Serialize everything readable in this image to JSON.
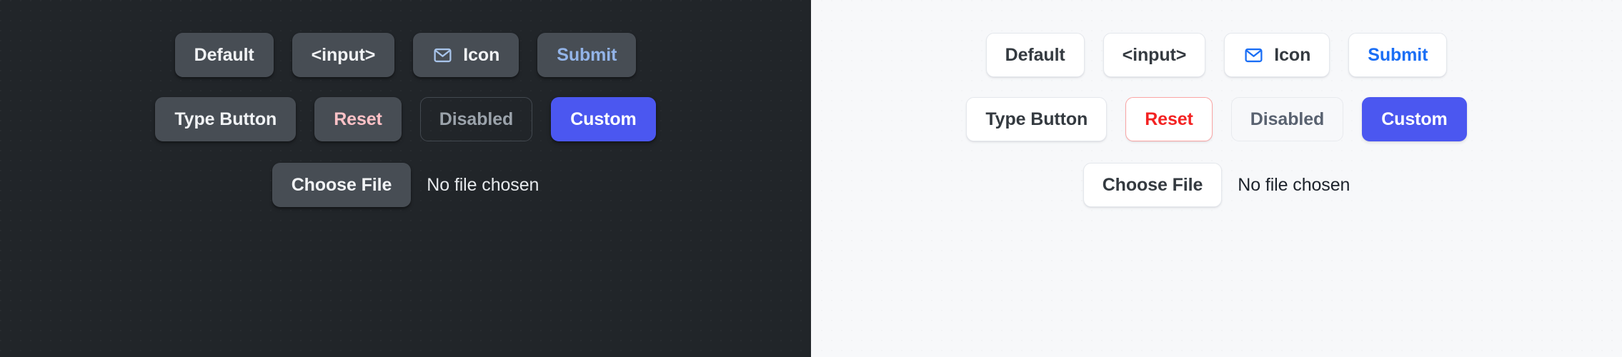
{
  "themes": [
    {
      "name": "dark",
      "colors": {
        "background": "#212529",
        "button_surface": "#474d54",
        "text": "#f1f3f5",
        "submit_text": "#93b4e8",
        "reset_text": "#ffc2c7",
        "disabled_text": "#9ba3ab",
        "disabled_border": "#434950",
        "custom_background": "#4b57f0",
        "custom_text": "#ffffff",
        "icon_stroke": "#a8c4ea",
        "file_name_text": "#e6e9ec"
      },
      "row1": [
        {
          "label": "Default",
          "variant": "base",
          "icon": null
        },
        {
          "label": "<input>",
          "variant": "base",
          "icon": null
        },
        {
          "label": "Icon",
          "variant": "base",
          "icon": "envelope-icon"
        },
        {
          "label": "Submit",
          "variant": "submit",
          "icon": null
        }
      ],
      "row2": [
        {
          "label": "Type Button",
          "variant": "base"
        },
        {
          "label": "Reset",
          "variant": "reset"
        },
        {
          "label": "Disabled",
          "variant": "disabled"
        },
        {
          "label": "Custom",
          "variant": "custom"
        }
      ],
      "file_input": {
        "button_label": "Choose File",
        "status_text": "No file chosen"
      }
    },
    {
      "name": "light",
      "colors": {
        "background": "#f7f8fa",
        "button_surface": "#ffffff",
        "button_border": "#e4e7ec",
        "text": "#343a40",
        "submit_text": "#1a6ef5",
        "reset_text": "#f32222",
        "reset_border": "#fba5a5",
        "disabled_text": "#596270",
        "disabled_background": "#f7f8fa",
        "disabled_border": "#e8eaee",
        "custom_background": "#4b57f0",
        "custom_text": "#ffffff",
        "icon_stroke": "#1a6ef5",
        "file_name_text": "#1c222b"
      },
      "row1": [
        {
          "label": "Default",
          "variant": "base",
          "icon": null
        },
        {
          "label": "<input>",
          "variant": "base",
          "icon": null
        },
        {
          "label": "Icon",
          "variant": "base",
          "icon": "envelope-icon"
        },
        {
          "label": "Submit",
          "variant": "submit",
          "icon": null
        }
      ],
      "row2": [
        {
          "label": "Type Button",
          "variant": "base"
        },
        {
          "label": "Reset",
          "variant": "reset"
        },
        {
          "label": "Disabled",
          "variant": "disabled"
        },
        {
          "label": "Custom",
          "variant": "custom"
        }
      ],
      "file_input": {
        "button_label": "Choose File",
        "status_text": "No file chosen"
      }
    }
  ]
}
